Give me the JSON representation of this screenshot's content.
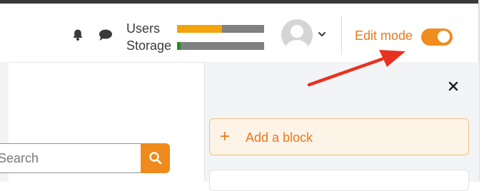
{
  "header": {
    "usage": {
      "users_label": "Users",
      "storage_label": "Storage",
      "users_fraction": 0.52,
      "storage_fraction": 0.04
    },
    "notifications_icon": "bell-icon",
    "messages_icon": "chat-icon",
    "user_menu_icon": "chevron-down-icon",
    "edit_mode": {
      "label": "Edit mode",
      "enabled": true
    }
  },
  "drawer": {
    "close_icon": "close-icon",
    "add_block": {
      "icon": "plus-icon",
      "label": "Add a block"
    }
  },
  "search": {
    "placeholder": "Search"
  },
  "colors": {
    "accent": "#f08b1d",
    "users_bar": "#f2a40a",
    "storage_bar": "#1d8f1d",
    "annotation_arrow": "#e8321f"
  }
}
